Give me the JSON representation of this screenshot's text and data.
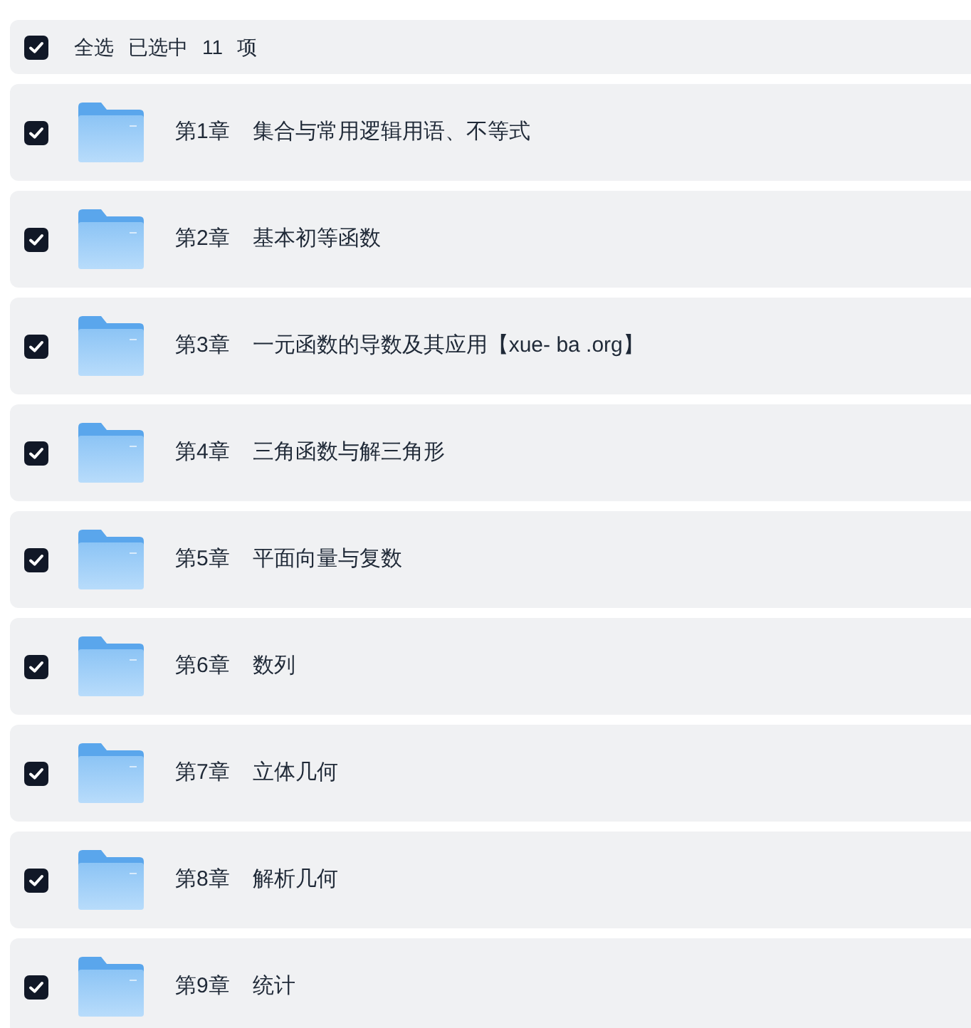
{
  "select_all": {
    "checked": true,
    "label": "全选",
    "status": "已选中",
    "count": "11",
    "unit": "项"
  },
  "folders": [
    {
      "chapter": "第1章",
      "title": "集合与常用逻辑用语、不等式",
      "checked": true
    },
    {
      "chapter": "第2章",
      "title": "基本初等函数",
      "checked": true
    },
    {
      "chapter": "第3章",
      "title": "一元函数的导数及其应用【xue- ba .org】",
      "checked": true
    },
    {
      "chapter": "第4章",
      "title": "三角函数与解三角形",
      "checked": true
    },
    {
      "chapter": "第5章",
      "title": "平面向量与复数",
      "checked": true
    },
    {
      "chapter": "第6章",
      "title": "数列",
      "checked": true
    },
    {
      "chapter": "第7章",
      "title": "立体几何",
      "checked": true
    },
    {
      "chapter": "第8章",
      "title": "解析几何",
      "checked": true
    },
    {
      "chapter": "第9章",
      "title": "统计",
      "checked": true
    }
  ]
}
